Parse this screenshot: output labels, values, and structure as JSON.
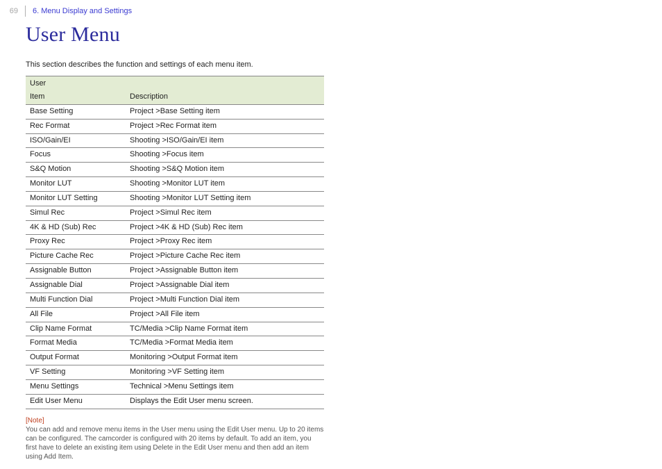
{
  "header": {
    "page_number": "69",
    "breadcrumb": "6. Menu Display and Settings"
  },
  "title": "User Menu",
  "intro": "This section describes the function and settings of each menu item.",
  "table": {
    "caption": "User",
    "col1": "Item",
    "col2": "Description",
    "rows": [
      {
        "item": "Base Setting",
        "desc": "Project >Base Setting item"
      },
      {
        "item": "Rec Format",
        "desc": "Project >Rec Format item"
      },
      {
        "item": "ISO/Gain/EI",
        "desc": "Shooting >ISO/Gain/EI item"
      },
      {
        "item": "Focus",
        "desc": "Shooting >Focus item"
      },
      {
        "item": "S&Q Motion",
        "desc": "Shooting >S&Q Motion item"
      },
      {
        "item": "Monitor LUT",
        "desc": "Shooting >Monitor LUT item"
      },
      {
        "item": "Monitor LUT Setting",
        "desc": "Shooting >Monitor LUT Setting item"
      },
      {
        "item": "Simul Rec",
        "desc": "Project >Simul Rec item"
      },
      {
        "item": "4K & HD (Sub) Rec",
        "desc": "Project >4K & HD (Sub) Rec item"
      },
      {
        "item": "Proxy Rec",
        "desc": "Project >Proxy Rec item"
      },
      {
        "item": "Picture Cache Rec",
        "desc": "Project >Picture Cache Rec item"
      },
      {
        "item": "Assignable Button",
        "desc": "Project >Assignable Button item"
      },
      {
        "item": "Assignable Dial",
        "desc": "Project >Assignable Dial item"
      },
      {
        "item": "Multi Function Dial",
        "desc": "Project >Multi Function Dial item"
      },
      {
        "item": "All File",
        "desc": "Project >All File item"
      },
      {
        "item": "Clip Name Format",
        "desc": "TC/Media >Clip Name Format item"
      },
      {
        "item": "Format Media",
        "desc": "TC/Media >Format Media item"
      },
      {
        "item": "Output Format",
        "desc": "Monitoring >Output Format item"
      },
      {
        "item": "VF Setting",
        "desc": "Monitoring >VF Setting item"
      },
      {
        "item": "Menu Settings",
        "desc": "Technical >Menu Settings item"
      },
      {
        "item": "Edit User Menu",
        "desc": "Displays the Edit User menu screen."
      }
    ]
  },
  "note": {
    "label": "[Note]",
    "text": "You can add and remove menu items in the User menu using the Edit User menu. Up to 20 items can be configured. The camcorder is configured with 20 items by default. To add an item, you first have to delete an existing item using Delete in the Edit User menu and then add an item using Add Item."
  }
}
